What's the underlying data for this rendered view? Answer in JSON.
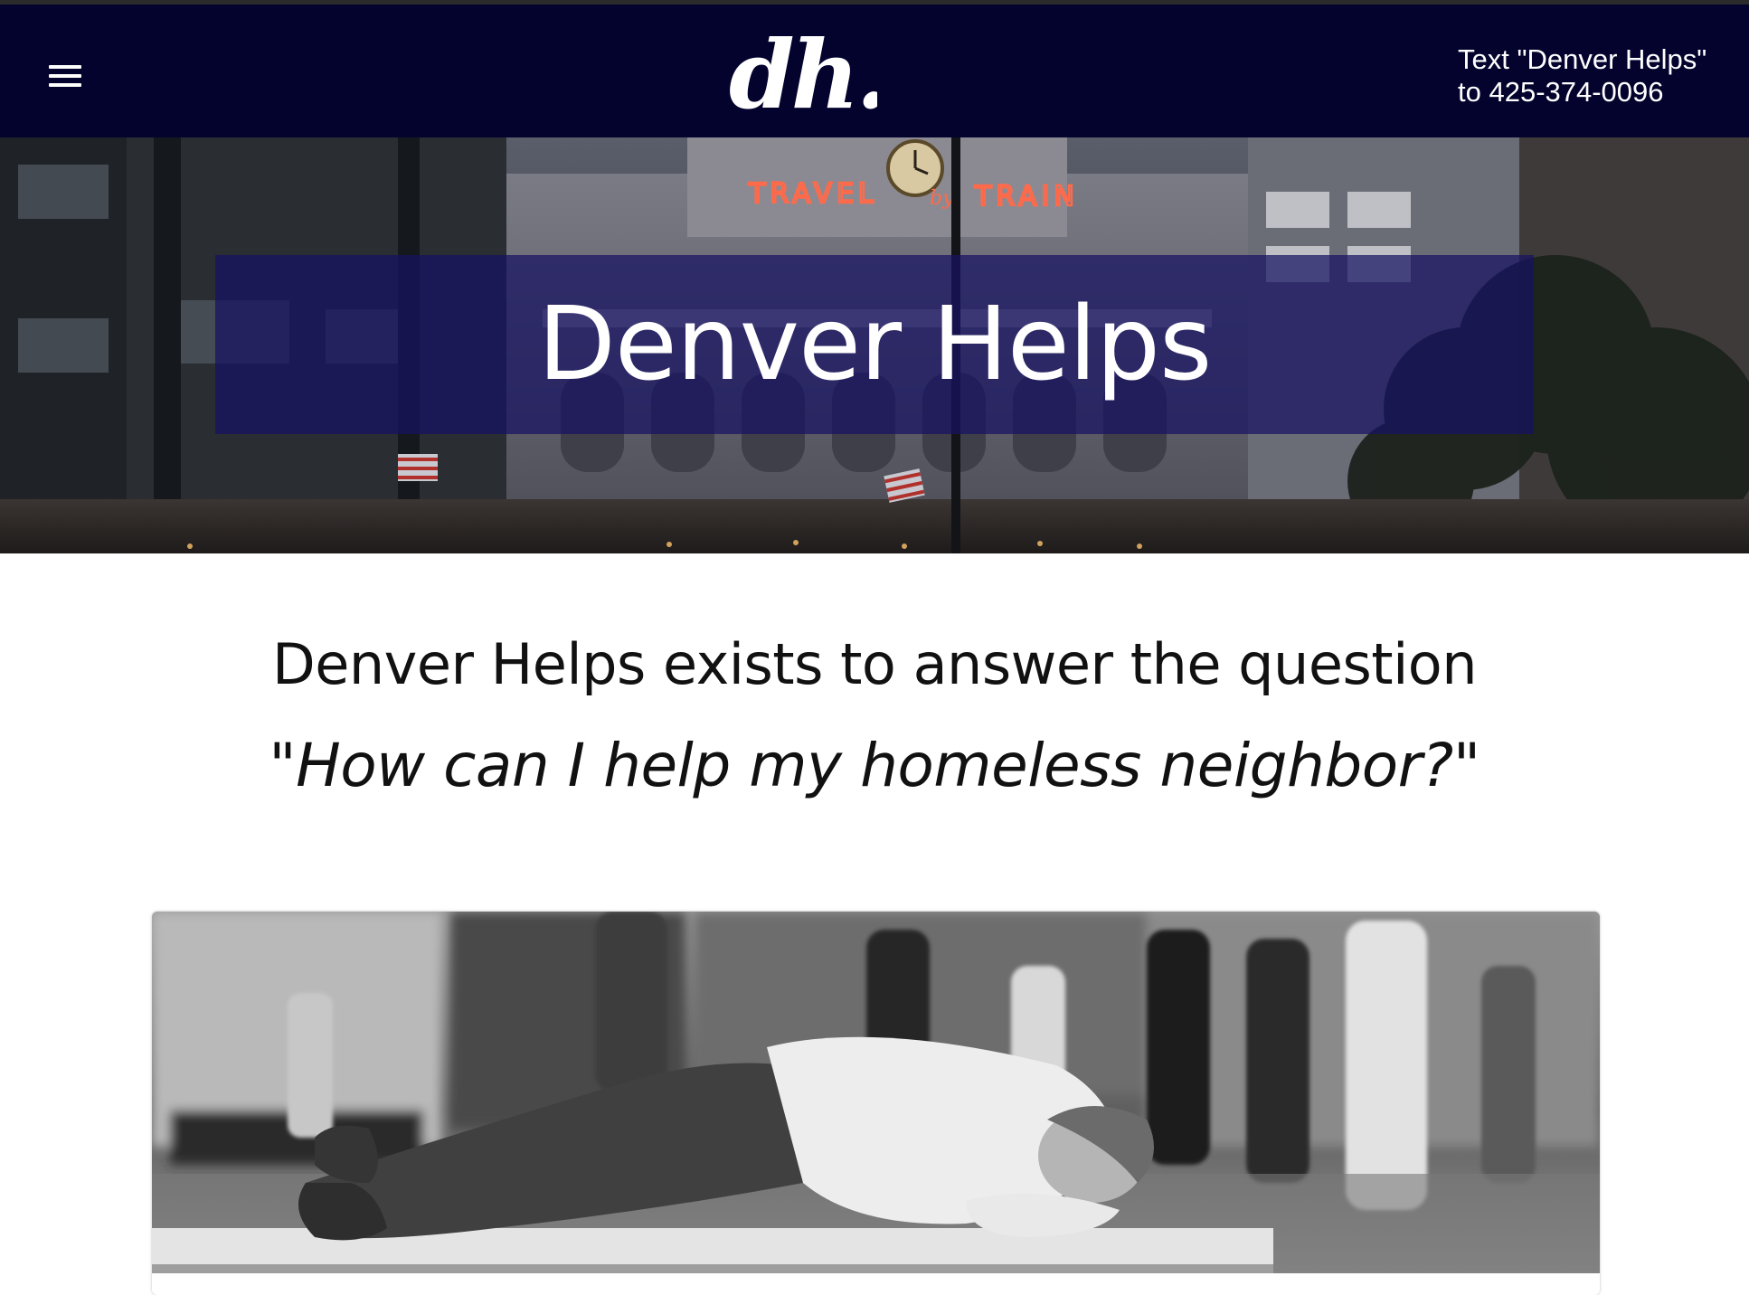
{
  "header": {
    "menu_icon": "hamburger-menu-icon",
    "logo_text": "dh.",
    "cta_line1": "Text \"Denver Helps\"",
    "cta_line2": "to 425-374-0096",
    "background_color": "#03032e"
  },
  "hero": {
    "title": "Denver Helps",
    "banner_color": "#16126280",
    "sign_text": "TRAVEL by TRAIN"
  },
  "intro": {
    "line": "Denver Helps exists to answer the question",
    "question": "\"How can I help my homeless neighbor?\""
  },
  "card": {
    "image_description_icon": "photo-image"
  }
}
